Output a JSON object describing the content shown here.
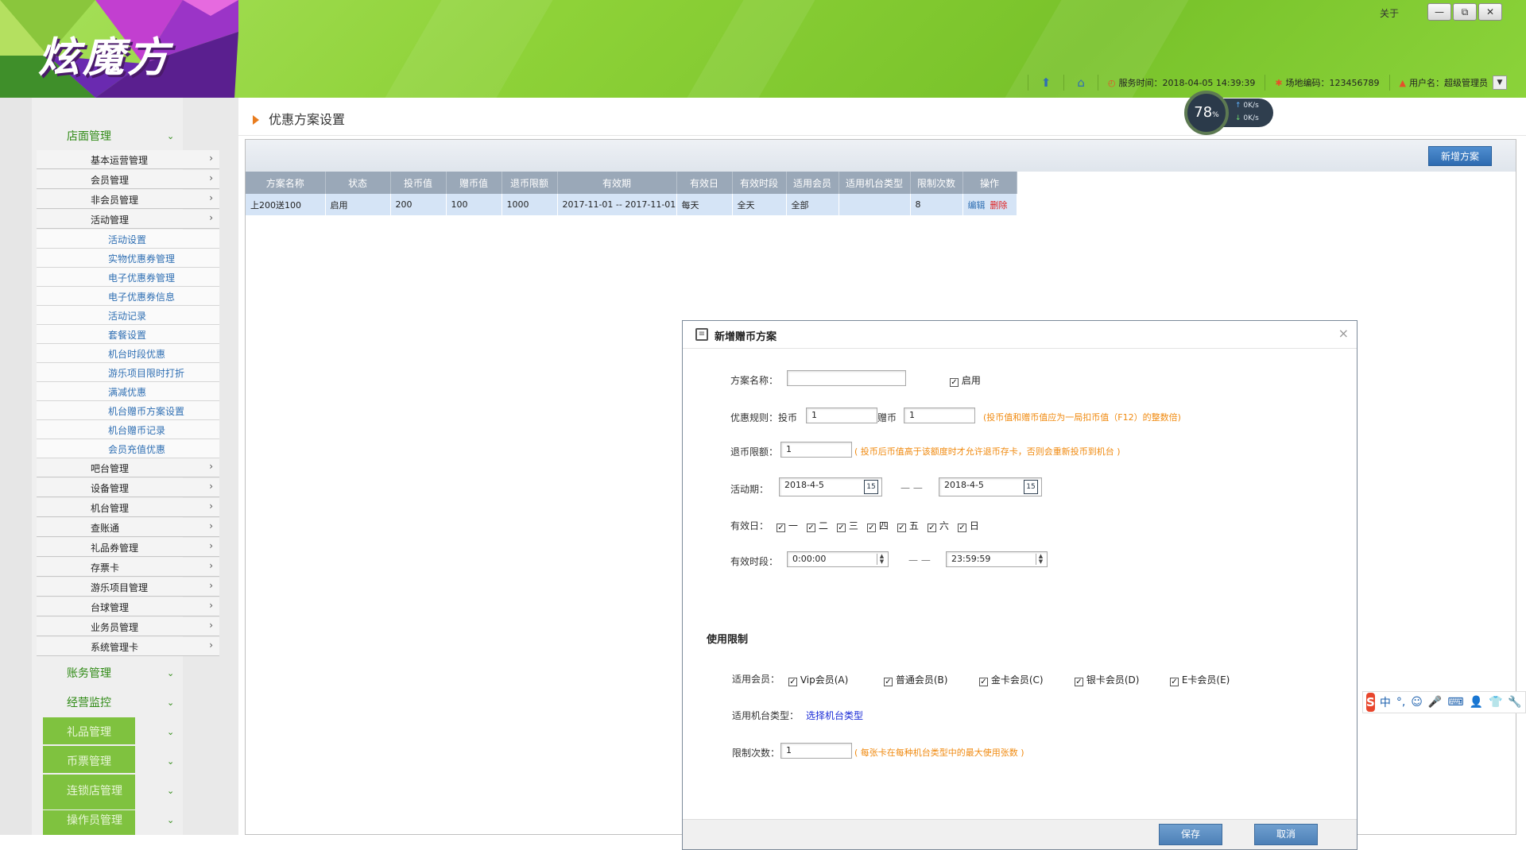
{
  "app": {
    "logo_text": "炫魔方",
    "about": "关于",
    "win_controls": {
      "minimize": "—",
      "restore": "⧉",
      "close": "✕"
    },
    "status": {
      "service_time_label": "服务时间：",
      "service_time": "2018-04-05 14:39:39",
      "venue_code_label": "场地编码：",
      "venue_code": "123456789",
      "user_label": "用户名：",
      "user": "超级管理员"
    }
  },
  "sidebar": {
    "groups": [
      {
        "label": "店面管理"
      },
      {
        "label": "账务管理"
      },
      {
        "label": "经营监控"
      },
      {
        "label": "礼品管理"
      },
      {
        "label": "币票管理"
      },
      {
        "label": "连锁店管理"
      },
      {
        "label": "操作员管理"
      }
    ],
    "store_items": [
      {
        "label": "基本运营管理"
      },
      {
        "label": "会员管理"
      },
      {
        "label": "非会员管理"
      },
      {
        "label": "活动管理"
      }
    ],
    "activity_items": [
      {
        "label": "活动设置"
      },
      {
        "label": "实物优惠券管理"
      },
      {
        "label": "电子优惠券管理"
      },
      {
        "label": "电子优惠券信息"
      },
      {
        "label": "活动记录"
      },
      {
        "label": "套餐设置"
      },
      {
        "label": "机台时段优惠"
      },
      {
        "label": "游乐项目限时打折"
      },
      {
        "label": "满减优惠"
      },
      {
        "label": "机台赠币方案设置"
      },
      {
        "label": "机台赠币记录"
      },
      {
        "label": "会员充值优惠"
      }
    ],
    "store_items_after": [
      {
        "label": "吧台管理"
      },
      {
        "label": "设备管理"
      },
      {
        "label": "机台管理"
      },
      {
        "label": "查账通"
      },
      {
        "label": "礼品券管理"
      },
      {
        "label": "存票卡"
      },
      {
        "label": "游乐项目管理"
      },
      {
        "label": "台球管理"
      },
      {
        "label": "业务员管理"
      },
      {
        "label": "系统管理卡"
      }
    ]
  },
  "main": {
    "title": "优惠方案设置",
    "add_button": "新增方案",
    "table": {
      "columns": [
        "方案名称",
        "状态",
        "投币值",
        "赠币值",
        "退币限额",
        "有效期",
        "有效日",
        "有效时段",
        "适用会员",
        "适用机台类型",
        "限制次数",
        "操作"
      ],
      "rows": [
        {
          "name": "上200送100",
          "status": "启用",
          "coin_in": "200",
          "bonus": "100",
          "refund_limit": "1000",
          "period": "2017-11-01 -- 2017-11-01",
          "days": "每天",
          "time_range": "全天",
          "members": "全部",
          "machine_types": "",
          "limit": "8",
          "edit": "编辑",
          "delete": "删除"
        }
      ]
    }
  },
  "dialog": {
    "title": "新增赠币方案",
    "close": "×",
    "name_label": "方案名称：",
    "name_value": "",
    "enable_label": "启用",
    "enabled": true,
    "rule_label": "优惠规则：",
    "coin_label": "投币",
    "coin_value": "1",
    "bonus_label": "赠币",
    "bonus_value": "1",
    "rule_hint": "(投币值和赠币值应为一局扣币值（F12）的整数倍)",
    "refund_label": "退币限额：",
    "refund_value": "1",
    "refund_hint": "( 投币后币值高于该额度时才允许退币存卡，否则会重新投币到机台 )",
    "period_label": "活动期：",
    "period_start": "2018-4-5",
    "period_end": "2018-4-5",
    "dash": "— —",
    "cal_icon": "15",
    "days_label": "有效日：",
    "days": [
      {
        "label": "一",
        "checked": true
      },
      {
        "label": "二",
        "checked": true
      },
      {
        "label": "三",
        "checked": true
      },
      {
        "label": "四",
        "checked": true
      },
      {
        "label": "五",
        "checked": true
      },
      {
        "label": "六",
        "checked": true
      },
      {
        "label": "日",
        "checked": true
      }
    ],
    "time_label": "有效时段：",
    "time_start": "0:00:00",
    "time_end": "23:59:59",
    "section_title": "使用限制",
    "members_label": "适用会员：",
    "members": [
      {
        "label": "Vip会员(A)",
        "checked": true
      },
      {
        "label": "普通会员(B)",
        "checked": true
      },
      {
        "label": "金卡会员(C)",
        "checked": true
      },
      {
        "label": "银卡会员(D)",
        "checked": true
      },
      {
        "label": "E卡会员(E)",
        "checked": true
      }
    ],
    "machine_label": "适用机台类型：",
    "machine_link": "选择机台类型",
    "limit_label": "限制次数：",
    "limit_value": "1",
    "limit_hint": "( 每张卡在每种机台类型中的最大使用张数 )",
    "save": "保存",
    "cancel": "取消"
  },
  "overlays": {
    "speed_percent": "78",
    "speed_unit": "%",
    "upload": "0K/s",
    "download": "0K/s",
    "ime_labels": [
      "中",
      "°,",
      "☺",
      "🎤",
      "⌨",
      "👤",
      "👕",
      "🔧"
    ],
    "ime_logo": "S"
  }
}
